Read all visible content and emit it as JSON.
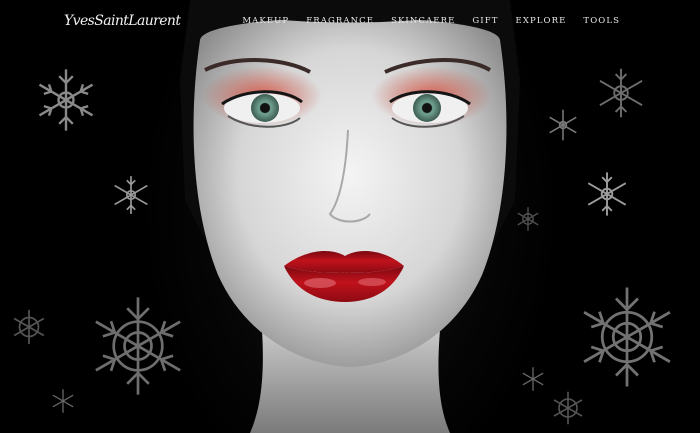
{
  "brand": {
    "logo_text": "YvesSaintLaurent"
  },
  "nav": {
    "items": [
      {
        "id": "makeup",
        "label": "MAKEUP"
      },
      {
        "id": "fragrance",
        "label": "FRAGRANCE"
      },
      {
        "id": "skincare",
        "label": "SKINCAERE"
      },
      {
        "id": "gift",
        "label": "GIFT"
      },
      {
        "id": "explore",
        "label": "EXPLORE"
      },
      {
        "id": "tools",
        "label": "TOOLS"
      }
    ]
  },
  "hero": {
    "image": "model-portrait-red-lips",
    "decoration": "snowflake-icon",
    "colors": {
      "background": "#000000",
      "lips": "#b0101a",
      "eyeshadow": "#c0412f",
      "snowflake": "#8a8a8a"
    }
  }
}
